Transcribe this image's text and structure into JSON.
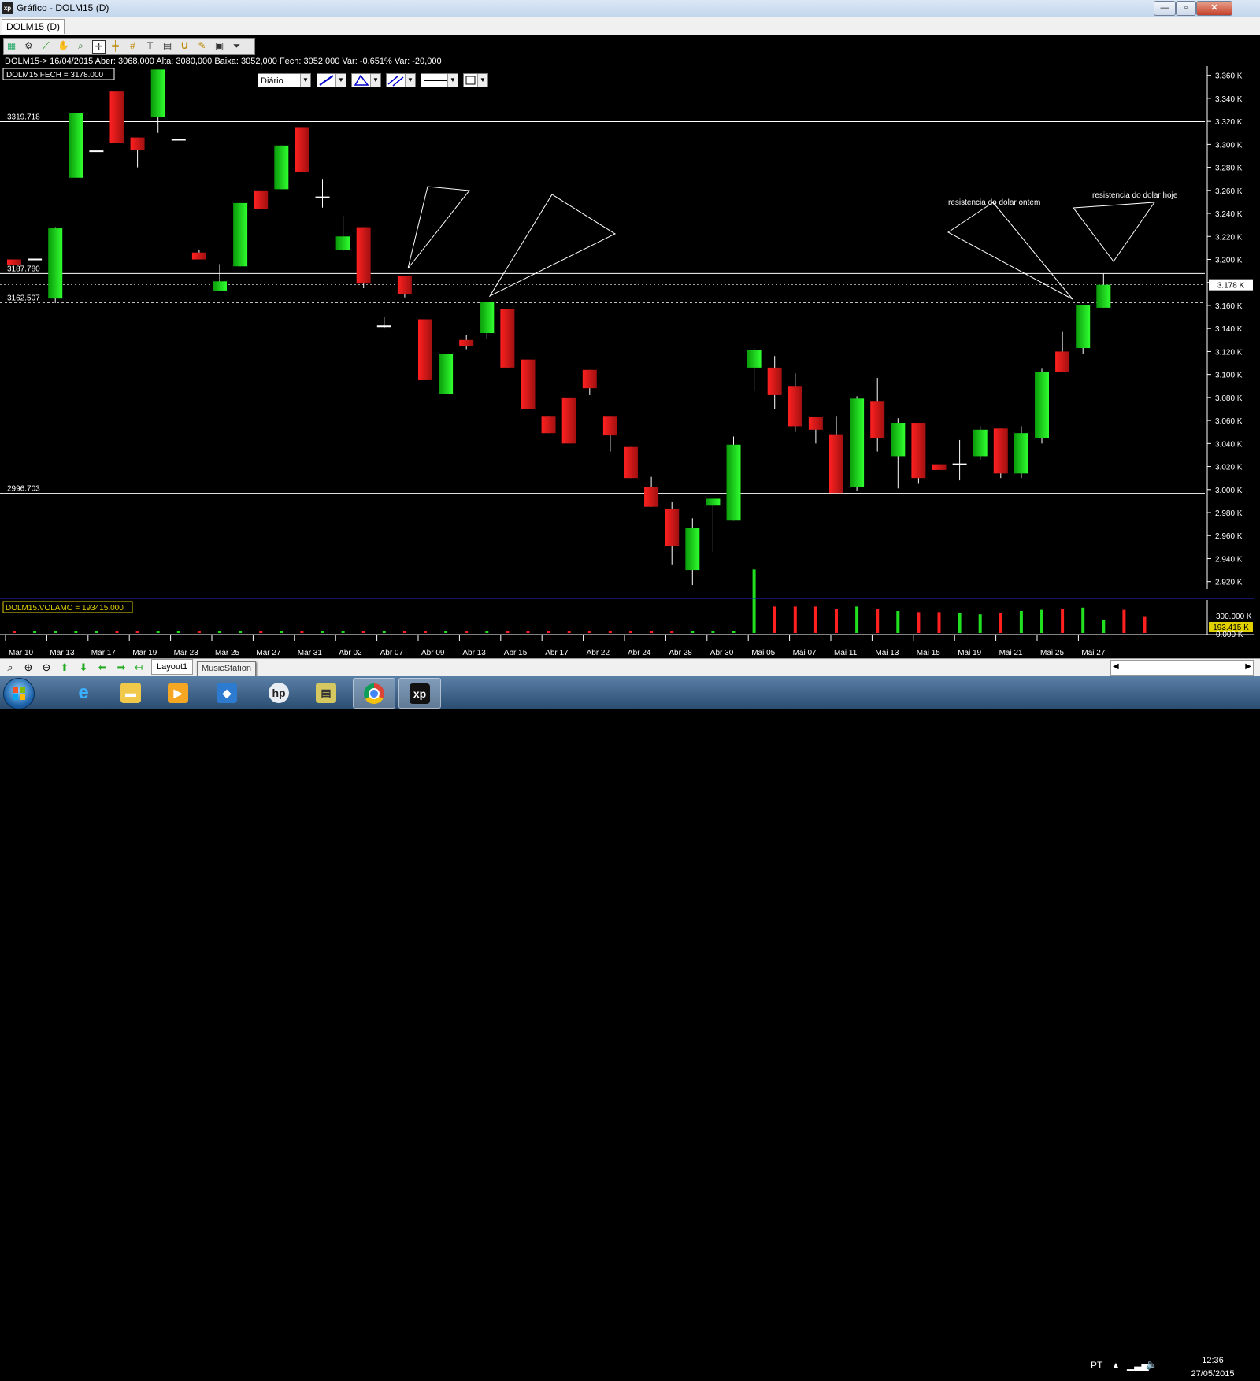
{
  "window": {
    "title": "Gráfico - DOLM15 (D)",
    "icon_label": "xp",
    "buttons": {
      "minimize": "—",
      "maximize": "▫",
      "close": "✕"
    }
  },
  "tab": {
    "label": "DOLM15 (D)"
  },
  "toolbar": {
    "icons": [
      "chart-icon",
      "gear-icon",
      "line-icon",
      "hand-icon",
      "zoom-icon",
      "crosshair-icon",
      "horizontal-line-icon",
      "fibonacci-icon",
      "text-icon",
      "magnet-icon",
      "wand-icon",
      "calculator-icon",
      "save-icon",
      "filter-icon"
    ],
    "period": "Diário"
  },
  "info_line": "DOLM15-> 16/04/2015 Aber: 3068,000 Alta: 3080,000 Baixa: 3052,000 Fech: 3052,000 Var: -0,651% Var: -20,000",
  "price_label": "DOLM15.FECH = 3178.000",
  "volume_label": "DOLM15.VOLAMO = 193415.000",
  "current_price_tag": "3.178 K",
  "current_volume_tag": "193.415 K",
  "annotations": {
    "yesterday": "resistencia do dolar ontem",
    "today": "resistencia do dolar hoje"
  },
  "chart_data": {
    "type": "candlestick",
    "ylim": [
      2915,
      3368
    ],
    "yticks": [
      3360,
      3340,
      3320,
      3300,
      3280,
      3260,
      3240,
      3220,
      3200,
      3180,
      3160,
      3140,
      3120,
      3100,
      3080,
      3060,
      3040,
      3020,
      3000,
      2980,
      2960,
      2940,
      2920
    ],
    "ytick_labels": [
      "3.360 K",
      "3.340 K",
      "3.320 K",
      "3.300 K",
      "3.280 K",
      "3.260 K",
      "3.240 K",
      "3.220 K",
      "3.200 K",
      "3.180 K",
      "3.160 K",
      "3.140 K",
      "3.120 K",
      "3.100 K",
      "3.080 K",
      "3.060 K",
      "3.040 K",
      "3.020 K",
      "3.000 K",
      "2.980 K",
      "2.960 K",
      "2.940 K",
      "2.920 K"
    ],
    "hlines": [
      {
        "value": 3319.718,
        "label": "3319.718",
        "style": "solid"
      },
      {
        "value": 3187.78,
        "label": "3187.780",
        "style": "solid"
      },
      {
        "value": 3162.507,
        "label": "3162.507",
        "style": "dashed"
      },
      {
        "value": 2996.703,
        "label": "2996.703",
        "style": "solid"
      }
    ],
    "xlabels": [
      "Mar 10",
      "Mar 13",
      "Mar 17",
      "Mar 19",
      "Mar 23",
      "Mar 25",
      "Mar 27",
      "Mar 31",
      "Abr 02",
      "Abr 07",
      "Abr 09",
      "Abr 13",
      "Abr 15",
      "Abr 17",
      "Abr 22",
      "Abr 24",
      "Abr 28",
      "Abr 30",
      "Mai 05",
      "Mai 07",
      "Mai 11",
      "Mai 13",
      "Mai 15",
      "Mai 19",
      "Mai 21",
      "Mai 25",
      "Mai 27"
    ],
    "candles": [
      {
        "o": 3200,
        "c": 3195,
        "h": 3200,
        "l": 3195
      },
      {
        "o": 3200,
        "c": 3200,
        "h": 3200,
        "l": 3200
      },
      {
        "o": 3166,
        "c": 3227,
        "h": 3228,
        "l": 3162
      },
      {
        "o": 3271,
        "c": 3327,
        "h": 3327,
        "l": 3271
      },
      {
        "o": 3294,
        "c": 3294,
        "h": 3294,
        "l": 3294
      },
      {
        "o": 3346,
        "c": 3301,
        "h": 3346,
        "l": 3301
      },
      {
        "o": 3306,
        "c": 3295,
        "h": 3306,
        "l": 3280
      },
      {
        "o": 3324,
        "c": 3365,
        "h": 3365,
        "l": 3310
      },
      {
        "o": 3304,
        "c": 3304,
        "h": 3304,
        "l": 3304
      },
      {
        "o": 3206,
        "c": 3200,
        "h": 3208,
        "l": 3200
      },
      {
        "o": 3173,
        "c": 3181,
        "h": 3196,
        "l": 3173
      },
      {
        "o": 3194,
        "c": 3249,
        "h": 3249,
        "l": 3194
      },
      {
        "o": 3260,
        "c": 3244,
        "h": 3260,
        "l": 3244
      },
      {
        "o": 3261,
        "c": 3299,
        "h": 3299,
        "l": 3261
      },
      {
        "o": 3315,
        "c": 3276,
        "h": 3315,
        "l": 3276
      },
      {
        "o": 3254,
        "c": 3254,
        "h": 3270,
        "l": 3245
      },
      {
        "o": 3208,
        "c": 3220,
        "h": 3238,
        "l": 3207
      },
      {
        "o": 3228,
        "c": 3179,
        "h": 3228,
        "l": 3175
      },
      {
        "o": 3142,
        "c": 3142,
        "h": 3150,
        "l": 3140
      },
      {
        "o": 3186,
        "c": 3170,
        "h": 3186,
        "l": 3167
      },
      {
        "o": 3148,
        "c": 3095,
        "h": 3148,
        "l": 3095
      },
      {
        "o": 3083,
        "c": 3118,
        "h": 3118,
        "l": 3083
      },
      {
        "o": 3130,
        "c": 3125,
        "h": 3134,
        "l": 3122
      },
      {
        "o": 3136,
        "c": 3163,
        "h": 3163,
        "l": 3131
      },
      {
        "o": 3157,
        "c": 3106,
        "h": 3157,
        "l": 3106
      },
      {
        "o": 3113,
        "c": 3070,
        "h": 3121,
        "l": 3070
      },
      {
        "o": 3064,
        "c": 3049,
        "h": 3064,
        "l": 3049
      },
      {
        "o": 3080,
        "c": 3040,
        "h": 3080,
        "l": 3040
      },
      {
        "o": 3104,
        "c": 3088,
        "h": 3104,
        "l": 3082
      },
      {
        "o": 3064,
        "c": 3047,
        "h": 3064,
        "l": 3033
      },
      {
        "o": 3037,
        "c": 3010,
        "h": 3037,
        "l": 3010
      },
      {
        "o": 3002,
        "c": 2985,
        "h": 3011,
        "l": 2985
      },
      {
        "o": 2983,
        "c": 2951,
        "h": 2989,
        "l": 2935
      },
      {
        "o": 2930,
        "c": 2967,
        "h": 2975,
        "l": 2917
      },
      {
        "o": 2986,
        "c": 2992,
        "h": 2992,
        "l": 2946
      },
      {
        "o": 2973,
        "c": 3039,
        "h": 3046,
        "l": 2973
      },
      {
        "o": 3106,
        "c": 3121,
        "h": 3123,
        "l": 3086
      },
      {
        "o": 3106,
        "c": 3082,
        "h": 3116,
        "l": 3070
      },
      {
        "o": 3090,
        "c": 3055,
        "h": 3101,
        "l": 3050
      },
      {
        "o": 3063,
        "c": 3052,
        "h": 3063,
        "l": 3040
      },
      {
        "o": 3048,
        "c": 2997,
        "h": 3064,
        "l": 2997
      },
      {
        "o": 3002,
        "c": 3079,
        "h": 3081,
        "l": 2999
      },
      {
        "o": 3077,
        "c": 3045,
        "h": 3097,
        "l": 3033
      },
      {
        "o": 3029,
        "c": 3058,
        "h": 3062,
        "l": 3001
      },
      {
        "o": 3058,
        "c": 3010,
        "h": 3058,
        "l": 3005
      },
      {
        "o": 3022,
        "c": 3017,
        "h": 3028,
        "l": 2986
      },
      {
        "o": 3022,
        "c": 3022,
        "h": 3043,
        "l": 3008
      },
      {
        "o": 3029,
        "c": 3052,
        "h": 3055,
        "l": 3026
      },
      {
        "o": 3053,
        "c": 3014,
        "h": 3053,
        "l": 3010
      },
      {
        "o": 3014,
        "c": 3049,
        "h": 3055,
        "l": 3010
      },
      {
        "o": 3045,
        "c": 3102,
        "h": 3105,
        "l": 3040
      },
      {
        "o": 3120,
        "c": 3102,
        "h": 3137,
        "l": 3102
      },
      {
        "o": 3123,
        "c": 3160,
        "h": 3160,
        "l": 3118
      },
      {
        "o": 3158,
        "c": 3178,
        "h": 3188,
        "l": 3158
      }
    ],
    "volumes_k": [
      2,
      3,
      3,
      2,
      2,
      3,
      2,
      2,
      3,
      2,
      2,
      2,
      2,
      2,
      3,
      2,
      2,
      2,
      2,
      2,
      3,
      2,
      2,
      2,
      3,
      2,
      2,
      3,
      2,
      2,
      3,
      2,
      3,
      3,
      2,
      2,
      288,
      120,
      120,
      120,
      110,
      120,
      110,
      100,
      95,
      95,
      90,
      85,
      90,
      100,
      105,
      110,
      115,
      60,
      105,
      73
    ]
  }
}
